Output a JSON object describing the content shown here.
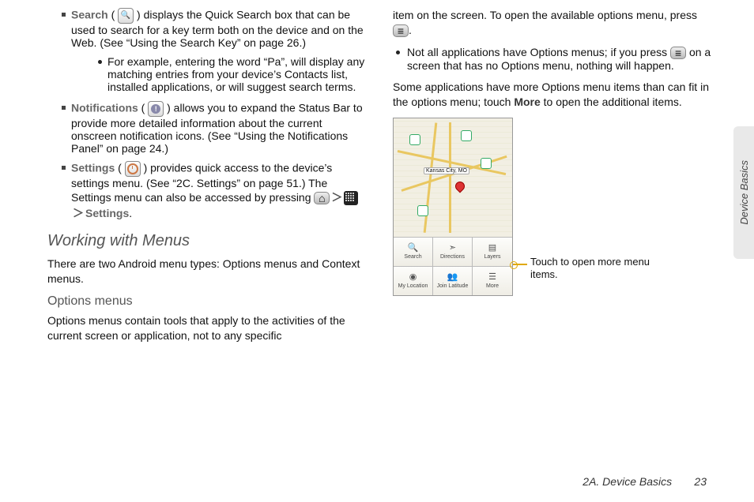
{
  "left": {
    "search_label": "Search",
    "search_text_a": " ( ",
    "search_text_b": " ) displays the Quick Search box that can be used to search for a key term both on the device and on the Web. (See “Using the Search Key” on page 26.)",
    "search_example": "For example, entering the word “Pa”, will display any matching entries from your device’s Contacts list, installed applications, or will suggest search terms.",
    "notif_label": "Notifications",
    "notif_text": " ) allows you to expand the Status Bar to provide more detailed information about the current onscreen notification icons. (See “Using the Notifications Panel” on page 24.)",
    "settings_label": "Settings",
    "settings_text_a": " ) provides quick access to the device’s settings menu. (See “2C. Settings” on page 51.) The Settings menu can also be accessed by pressing ",
    "settings_tail": "Settings",
    "heading": "Working with Menus",
    "intro": "There are two Android menu types: Options menus and Context menus.",
    "options_h": "Options menus",
    "options_p": "Options menus contain tools that apply to the activities of the current screen or application, not to any specific"
  },
  "right": {
    "cont": "item on the screen. To open the available options menu, press ",
    "cont_tail": ".",
    "not_all": "Not all applications have Options menus; if you press ",
    "not_all_tail": " on a screen that has no Options menu, nothing will happen.",
    "some_a": "Some applications have more Options menu items than can fit in the options menu; touch ",
    "some_more": "More",
    "some_b": " to open the additional items.",
    "map_label": "Kansas City, MO",
    "menu": [
      {
        "icon": "🔍",
        "label": "Search"
      },
      {
        "icon": "↗",
        "label": "Directions"
      },
      {
        "icon": "▤",
        "label": "Layers"
      },
      {
        "icon": "◉",
        "label": "My Location"
      },
      {
        "icon": "👥",
        "label": "Join Latitude"
      },
      {
        "icon": "⋯",
        "label": "More"
      }
    ],
    "annot": "Touch to open more menu items."
  },
  "side_tab": "Device Basics",
  "footer_section": "2A. Device Basics",
  "footer_page": "23"
}
